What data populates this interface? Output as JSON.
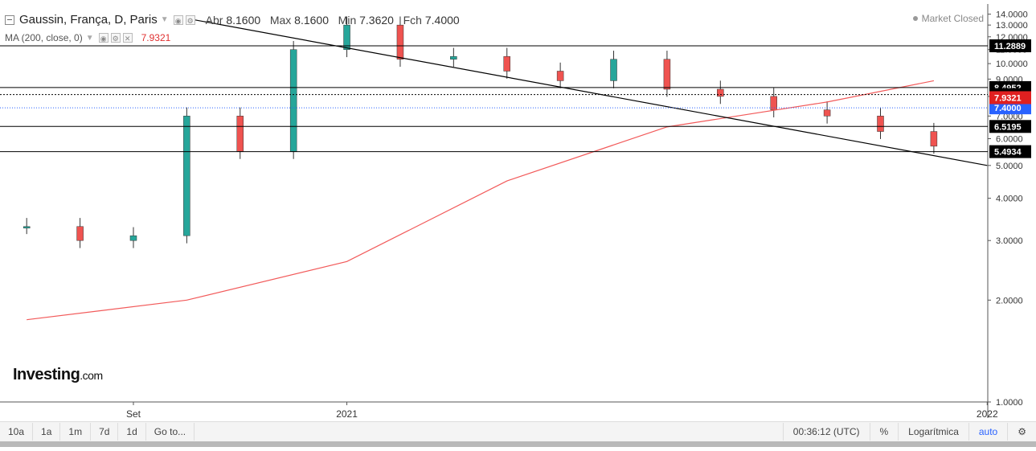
{
  "header": {
    "symbol": "Gaussin, França, D, Paris",
    "open_label": "Abr",
    "open_value": "8.1600",
    "high_label": "Max",
    "high_value": "8.1600",
    "low_label": "Min",
    "low_value": "7.3620",
    "close_label": "Fch",
    "close_value": "7.4000",
    "market_status": "Market Closed"
  },
  "indicator": {
    "label": "MA (200, close, 0)",
    "value": "7.9321"
  },
  "logo": {
    "main": "Investing",
    "suffix": ".com"
  },
  "toolbar": {
    "ranges": [
      "10a",
      "1a",
      "1m",
      "7d",
      "1d"
    ],
    "goto": "Go to...",
    "clock": "00:36:12 (UTC)",
    "percent": "%",
    "log": "Logarítmica",
    "auto": "auto"
  },
  "colors": {
    "up": "#26a69a",
    "down": "#ef5350",
    "ma": "#f25a5a",
    "trendline": "#000000",
    "close_line": "#2962ff"
  },
  "chart_data": {
    "type": "line",
    "scale": "log",
    "ylim": [
      1.0,
      15.0
    ],
    "yticks": [
      "14.0000",
      "13.0000",
      "12.0000",
      "11.0000",
      "10.0000",
      "9.0000",
      "8.0000",
      "7.0000",
      "6.0000",
      "5.0000",
      "4.0000",
      "3.0000",
      "2.0000",
      "1.0000"
    ],
    "xticks": [
      "Set",
      "2021",
      "2022"
    ],
    "series": [
      {
        "x": [
          "2020-07",
          "2020-08",
          "2020-09",
          "2020-10",
          "2020-11",
          "2020-12",
          "2021-01",
          "2021-02",
          "2021-03",
          "2021-04",
          "2021-05",
          "2021-06",
          "2021-07",
          "2021-08",
          "2021-09",
          "2021-10",
          "2021-11",
          "2021-12"
        ],
        "values": [
          3.3,
          3.0,
          3.1,
          7.0,
          5.5,
          11.0,
          13.0,
          10.3,
          10.5,
          9.5,
          8.9,
          10.3,
          8.4,
          8.0,
          7.3,
          7.0,
          6.3,
          5.7
        ]
      },
      {
        "name": "MA (200, close, 0)",
        "x": [
          "2020-07",
          "2020-10",
          "2021-01",
          "2021-04",
          "2021-07",
          "2021-10",
          "2021-12"
        ],
        "values": [
          1.75,
          2.0,
          2.6,
          4.5,
          6.5,
          7.7,
          8.9
        ]
      }
    ],
    "horizontal_levels": [
      "11.2889",
      "8.4952",
      "8.1027",
      "6.5195",
      "5.4934"
    ],
    "current_ma": "7.9321",
    "current_close": "7.4000",
    "trendline": {
      "from": [
        "2020-10",
        13.6
      ],
      "to": [
        "2022-01",
        5.0
      ]
    }
  }
}
